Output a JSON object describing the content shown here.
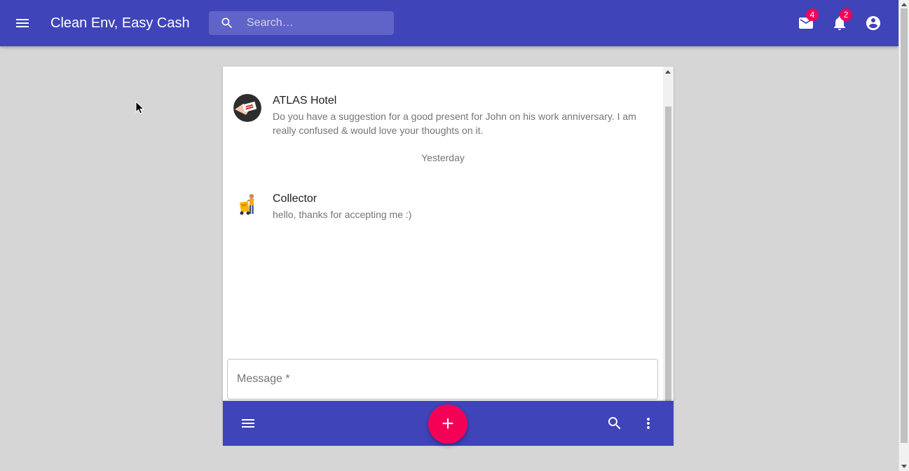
{
  "header": {
    "title": "Clean Env, Easy Cash",
    "search_placeholder": "Search…",
    "mail_badge": "4",
    "notifications_badge": "2"
  },
  "messages": [
    {
      "name": "ATLAS Hotel",
      "text": "Do you have a suggestion for a good present for John on his work anniversary. I am really confused & would love your thoughts on it."
    },
    {
      "name": "Collector",
      "text": "hello, thanks for accepting me :)"
    }
  ],
  "day_separator": "Yesterday",
  "composer": {
    "placeholder": "Message *"
  },
  "bottom_bar": {
    "fab_label": "+"
  },
  "colors": {
    "primary": "#3f44b8",
    "accent": "#f50057",
    "background": "#d6d6d6"
  }
}
